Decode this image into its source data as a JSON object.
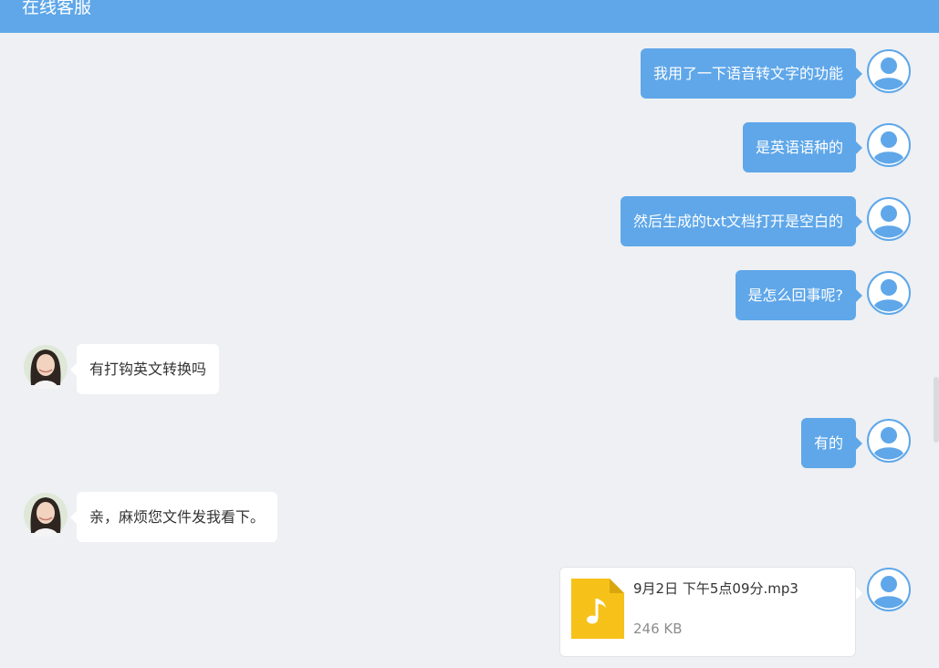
{
  "header": {
    "title": "在线客服"
  },
  "messages": [
    {
      "from": "user",
      "text": "我用了一下语音转文字的功能"
    },
    {
      "from": "user",
      "text": "是英语语种的"
    },
    {
      "from": "user",
      "text": "然后生成的txt文档打开是空白的"
    },
    {
      "from": "user",
      "text": "是怎么回事呢?"
    },
    {
      "from": "agent",
      "text": "有打钩英文转换吗"
    },
    {
      "from": "user",
      "text": "有的"
    },
    {
      "from": "agent",
      "text": "亲，麻烦您文件发我看下。"
    },
    {
      "from": "user",
      "type": "file",
      "file_name": "9月2日 下午5点09分.mp3",
      "file_size": "246 KB",
      "icon": "music-file-icon"
    }
  ],
  "colors": {
    "brand": "#5fa7e9",
    "background": "#eef0f3",
    "file_icon": "#f6c21a"
  }
}
